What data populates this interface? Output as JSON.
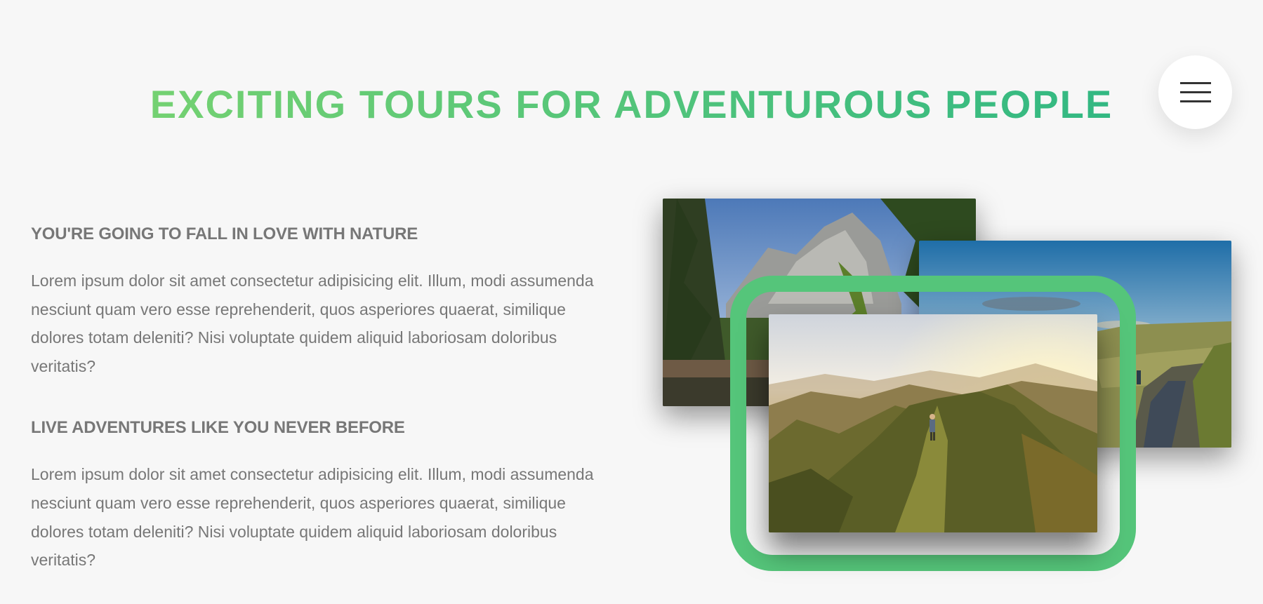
{
  "section": {
    "title": "EXCITING TOURS FOR ADVENTUROUS PEOPLE"
  },
  "navigation": {
    "menu_icon": "hamburger-menu-icon"
  },
  "features": [
    {
      "heading": "YOU'RE GOING TO FALL IN LOVE WITH NATURE",
      "paragraph": "Lorem ipsum dolor sit amet consectetur adipisicing elit. Illum, modi assumenda nesciunt quam vero esse reprehenderit, quos asperiores quaerat, similique dolores totam deleniti? Nisi voluptate quidem aliquid laboriosam doloribus veritatis?"
    },
    {
      "heading": "LIVE ADVENTURES LIKE YOU NEVER BEFORE",
      "paragraph": "Lorem ipsum dolor sit amet consectetur adipisicing elit. Illum, modi assumenda nesciunt quam vero esse reprehenderit, quos asperiores quaerat, similique dolores totam deleniti? Nisi voluptate quidem aliquid laboriosam doloribus veritatis?"
    }
  ],
  "composition": {
    "photos": [
      "forest-mountain-photo",
      "road-cyclist-photo",
      "mountain-ridge-hiker-photo"
    ],
    "highlight_color": "#55c57a"
  },
  "colors": {
    "gradient_start": "#7ed56f",
    "gradient_end": "#28b485",
    "background": "#f7f7f7",
    "text": "#777777"
  }
}
